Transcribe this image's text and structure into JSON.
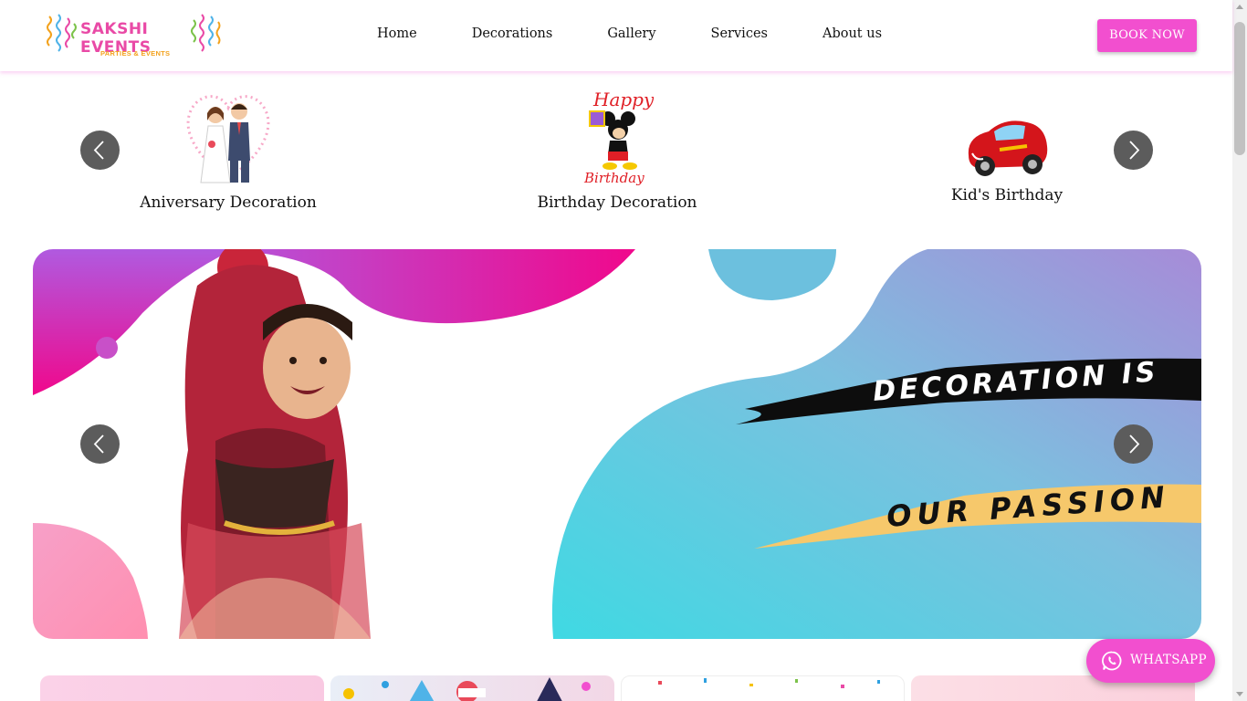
{
  "header": {
    "logo": {
      "brand": "SAKSHI EVENTS",
      "tagline": "PARTIES & EVENTS"
    },
    "nav": [
      {
        "label": "Home"
      },
      {
        "label": "Decorations"
      },
      {
        "label": "Gallery"
      },
      {
        "label": "Services"
      },
      {
        "label": "About us"
      }
    ],
    "book_label": "BOOK NOW"
  },
  "categories": [
    {
      "label": "Aniversary Decoration",
      "icon": "wedding-couple-icon"
    },
    {
      "label": "Birthday Decoration",
      "icon": "happy-birthday-mickey-icon"
    },
    {
      "label": "Kid's Birthday",
      "icon": "race-car-icon"
    }
  ],
  "banner": {
    "line1": "DECORATION IS",
    "line2": "OUR PASSION",
    "colors": {
      "pink": "#f0088c",
      "cyan": "#3fd9e3",
      "purple": "#a78bd8",
      "yellow": "#f6c86b"
    }
  },
  "whatsapp": {
    "label": "WHATSAPP",
    "color": "#f24fcf"
  },
  "theme": {
    "accent": "#f24fcf"
  }
}
